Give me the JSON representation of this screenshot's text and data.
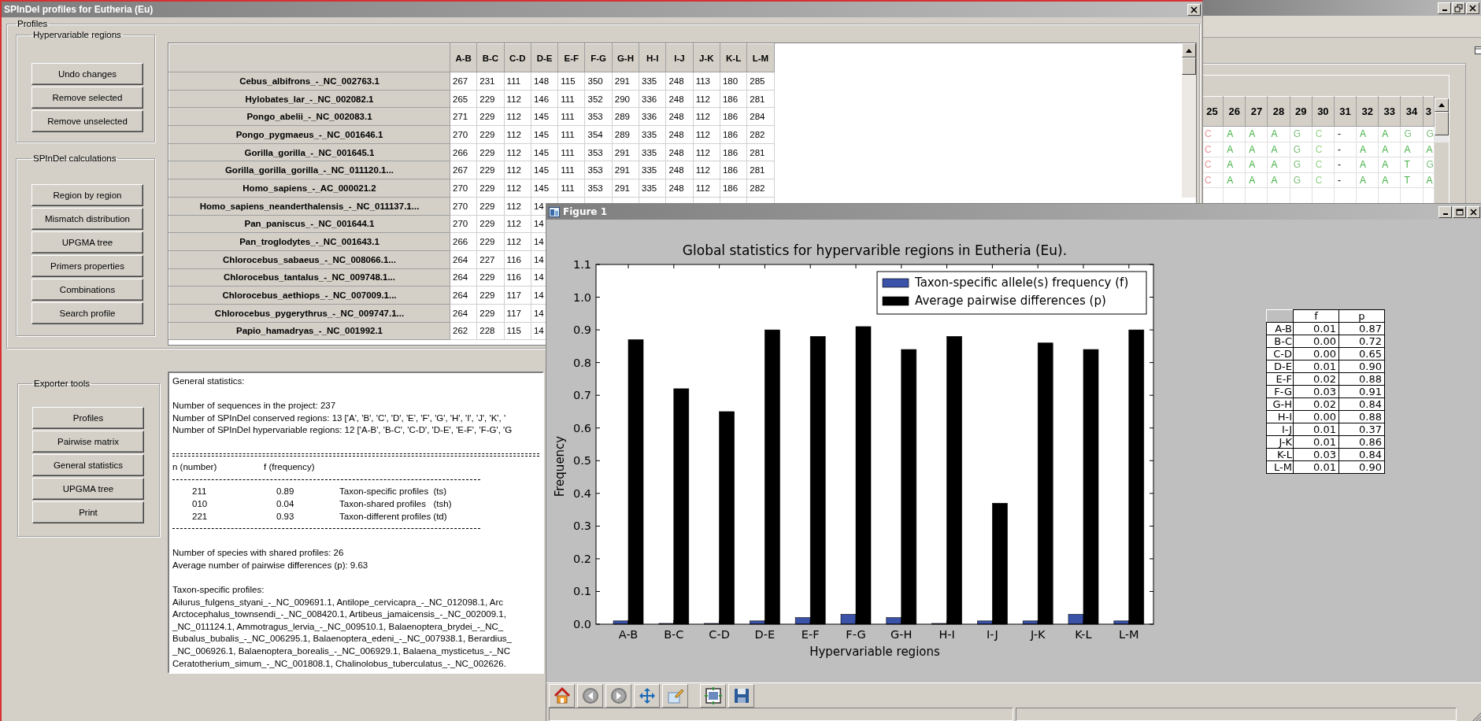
{
  "sequence_window": {
    "columns": [
      "25",
      "26",
      "27",
      "28",
      "29",
      "30",
      "31",
      "32",
      "33",
      "34",
      "3"
    ],
    "rows": [
      {
        "cells": [
          {
            "text": "C",
            "color": "#e89a9a"
          },
          {
            "text": "A",
            "color": "#44b044"
          },
          {
            "text": "A",
            "color": "#44b044"
          },
          {
            "text": "A",
            "color": "#44b044"
          },
          {
            "text": "G",
            "color": "#80c080"
          },
          {
            "text": "C",
            "color": "#98d488"
          },
          {
            "text": "-"
          },
          {
            "text": "A",
            "color": "#44b044"
          },
          {
            "text": "A",
            "color": "#44b044"
          },
          {
            "text": "G",
            "color": "#80c080"
          },
          {
            "text": "G",
            "color": "#80c080"
          }
        ]
      },
      {
        "cells": [
          {
            "text": "C",
            "color": "#e89a9a"
          },
          {
            "text": "A",
            "color": "#44b044"
          },
          {
            "text": "A",
            "color": "#44b044"
          },
          {
            "text": "A",
            "color": "#44b044"
          },
          {
            "text": "G",
            "color": "#80c080"
          },
          {
            "text": "C",
            "color": "#98d488"
          },
          {
            "text": "-"
          },
          {
            "text": "A",
            "color": "#44b044"
          },
          {
            "text": "A",
            "color": "#44b044"
          },
          {
            "text": "A",
            "color": "#44b044"
          },
          {
            "text": "A",
            "color": "#44b044"
          }
        ]
      },
      {
        "cells": [
          {
            "text": "C",
            "color": "#e89a9a"
          },
          {
            "text": "A",
            "color": "#44b044"
          },
          {
            "text": "A",
            "color": "#44b044"
          },
          {
            "text": "A",
            "color": "#44b044"
          },
          {
            "text": "G",
            "color": "#80c080"
          },
          {
            "text": "C",
            "color": "#98d488"
          },
          {
            "text": "-"
          },
          {
            "text": "A",
            "color": "#44b044"
          },
          {
            "text": "A",
            "color": "#44b044"
          },
          {
            "text": "T",
            "color": "#44b044"
          },
          {
            "text": "G",
            "color": "#80c080"
          }
        ]
      },
      {
        "cells": [
          {
            "text": "C",
            "color": "#e89a9a"
          },
          {
            "text": "A",
            "color": "#44b044"
          },
          {
            "text": "A",
            "color": "#44b044"
          },
          {
            "text": "A",
            "color": "#44b044"
          },
          {
            "text": "G",
            "color": "#80c080"
          },
          {
            "text": "C",
            "color": "#98d488"
          },
          {
            "text": "-"
          },
          {
            "text": "A",
            "color": "#44b044"
          },
          {
            "text": "A",
            "color": "#44b044"
          },
          {
            "text": "T",
            "color": "#44b044"
          },
          {
            "text": "A",
            "color": "#44b044"
          }
        ]
      }
    ]
  },
  "main_window": {
    "title": "SPInDel profiles for Eutheria (Eu)",
    "profiles": {
      "title": "Profiles",
      "hypervariable_regions": {
        "title": "Hypervariable regions",
        "buttons": [
          "Undo changes",
          "Remove selected",
          "Remove unselected"
        ]
      },
      "calculations": {
        "title": "SPInDel calculations",
        "buttons": [
          "Region by region",
          "Mismatch distribution",
          "UPGMA tree",
          "Primers properties",
          "Combinations",
          "Search profile"
        ]
      },
      "table": {
        "columns": [
          "A-B",
          "B-C",
          "C-D",
          "D-E",
          "E-F",
          "F-G",
          "G-H",
          "H-I",
          "I-J",
          "J-K",
          "K-L",
          "L-M"
        ],
        "rows": [
          {
            "name": "Cebus_albifrons_-_NC_002763.1",
            "values": [
              "267",
              "231",
              "111",
              "148",
              "115",
              "350",
              "291",
              "335",
              "248",
              "113",
              "180",
              "285"
            ]
          },
          {
            "name": "Hylobates_lar_-_NC_002082.1",
            "values": [
              "265",
              "229",
              "112",
              "146",
              "111",
              "352",
              "290",
              "336",
              "248",
              "112",
              "186",
              "281"
            ]
          },
          {
            "name": "Pongo_abelii_-_NC_002083.1",
            "values": [
              "271",
              "229",
              "112",
              "145",
              "111",
              "353",
              "289",
              "336",
              "248",
              "112",
              "186",
              "284"
            ]
          },
          {
            "name": "Pongo_pygmaeus_-_NC_001646.1",
            "values": [
              "270",
              "229",
              "112",
              "145",
              "111",
              "354",
              "289",
              "335",
              "248",
              "112",
              "186",
              "282"
            ]
          },
          {
            "name": "Gorilla_gorilla_-_NC_001645.1",
            "values": [
              "266",
              "229",
              "112",
              "145",
              "111",
              "353",
              "291",
              "335",
              "248",
              "112",
              "186",
              "281"
            ]
          },
          {
            "name": "Gorilla_gorilla_gorilla_-_NC_011120.1...",
            "values": [
              "267",
              "229",
              "112",
              "145",
              "111",
              "353",
              "291",
              "335",
              "248",
              "112",
              "186",
              "281"
            ]
          },
          {
            "name": "Homo_sapiens_-_AC_000021.2",
            "values": [
              "270",
              "229",
              "112",
              "145",
              "111",
              "353",
              "291",
              "335",
              "248",
              "112",
              "186",
              "282"
            ]
          },
          {
            "name": "Homo_sapiens_neanderthalensis_-_NC_011137.1...",
            "values": [
              "270",
              "229",
              "112",
              "14"
            ]
          },
          {
            "name": "Pan_paniscus_-_NC_001644.1",
            "values": [
              "270",
              "229",
              "112",
              "14"
            ]
          },
          {
            "name": "Pan_troglodytes_-_NC_001643.1",
            "values": [
              "266",
              "229",
              "112",
              "14"
            ]
          },
          {
            "name": "Chlorocebus_sabaeus_-_NC_008066.1...",
            "values": [
              "264",
              "227",
              "116",
              "14"
            ]
          },
          {
            "name": "Chlorocebus_tantalus_-_NC_009748.1...",
            "values": [
              "264",
              "229",
              "116",
              "14"
            ]
          },
          {
            "name": "Chlorocebus_aethiops_-_NC_007009.1...",
            "values": [
              "264",
              "229",
              "117",
              "14"
            ]
          },
          {
            "name": "Chlorocebus_pygerythrus_-_NC_009747.1...",
            "values": [
              "264",
              "229",
              "117",
              "14"
            ]
          },
          {
            "name": "Papio_hamadryas_-_NC_001992.1",
            "values": [
              "262",
              "228",
              "115",
              "14"
            ]
          }
        ]
      }
    },
    "exporter_tools": {
      "title": "Exporter tools",
      "buttons": [
        "Profiles",
        "Pairwise matrix",
        "General statistics",
        "UPGMA tree",
        "Print"
      ]
    },
    "output_text": {
      "heading": "General statistics:",
      "summary_lines": [
        "Number of sequences in the project: 237",
        "Number of SPInDel conserved regions: 13 ['A', 'B', 'C', 'D', 'E', 'F', 'G', 'H', 'I', 'J', 'K', '",
        "Number of SPInDel hypervariable regions: 12 ['A-B', 'B-C', 'C-D', 'D-E', 'E-F', 'F-G', 'G"
      ],
      "stats_header": [
        "n (number)",
        "f (frequency)"
      ],
      "stats_rows": [
        {
          "n": "211",
          "f": "0.89",
          "label": "Taxon-specific profiles  (ts)"
        },
        {
          "n": "010",
          "f": "0.04",
          "label": "Taxon-shared profiles   (tsh)"
        },
        {
          "n": "221",
          "f": "0.93",
          "label": "Taxon-different profiles (td)"
        }
      ],
      "notes": [
        "Number of species with shared profiles: 26",
        "Average number of pairwise differences (p): 9.63"
      ],
      "list_heading": "Taxon-specific profiles:",
      "list_lines": [
        "Ailurus_fulgens_styani_-_NC_009691.1, Antilope_cervicapra_-_NC_012098.1, Arc",
        "Arctocephalus_townsendi_-_NC_008420.1, Artibeus_jamaicensis_-_NC_002009.1,",
        "_NC_011124.1, Ammotragus_lervia_-_NC_009510.1, Balaenoptera_brydei_-_NC_",
        "Bubalus_bubalis_-_NC_006295.1, Balaenoptera_edeni_-_NC_007938.1, Berardius_",
        "_NC_006926.1, Balaenoptera_borealis_-_NC_006929.1, Balaena_mysticetus_-_NC",
        "Ceratotherium_simum_-_NC_001808.1, Chalinolobus_tuberculatus_-_NC_002626."
      ]
    }
  },
  "figure_window": {
    "title": "Figure 1",
    "chart_data": {
      "type": "bar",
      "title": "Global statistics for hypervarible regions in Eutheria (Eu).",
      "xlabel": "Hypervariable regions",
      "ylabel": "Frequency",
      "categories": [
        "A-B",
        "B-C",
        "C-D",
        "D-E",
        "E-F",
        "F-G",
        "G-H",
        "H-I",
        "I-J",
        "J-K",
        "K-L",
        "L-M"
      ],
      "series": [
        {
          "name": "Taxon-specific allele(s) frequency (f)",
          "color": "#3a52a8",
          "values": [
            0.01,
            0.0,
            0.0,
            0.01,
            0.02,
            0.03,
            0.02,
            0.0,
            0.01,
            0.01,
            0.03,
            0.01
          ]
        },
        {
          "name": "Average pairwise differences (p)",
          "color": "#000000",
          "values": [
            0.87,
            0.72,
            0.65,
            0.9,
            0.88,
            0.91,
            0.84,
            0.88,
            0.37,
            0.86,
            0.84,
            0.9
          ]
        }
      ],
      "legend": true,
      "ylim": [
        0,
        1.1
      ],
      "yticks": [
        {
          "value": 0,
          "label": "0.0"
        },
        0.1,
        0.2,
        0.3,
        0.4,
        0.5,
        0.6,
        0.7,
        0.8,
        0.9,
        {
          "value": 1,
          "label": "1.0"
        },
        1.1
      ]
    },
    "stats_table": {
      "columns": [
        "f",
        "p"
      ],
      "rows": [
        {
          "label": "A-B",
          "f": "0.01",
          "p": "0.87"
        },
        {
          "label": "B-C",
          "f": "0.00",
          "p": "0.72"
        },
        {
          "label": "C-D",
          "f": "0.00",
          "p": "0.65"
        },
        {
          "label": "D-E",
          "f": "0.01",
          "p": "0.90"
        },
        {
          "label": "E-F",
          "f": "0.02",
          "p": "0.88"
        },
        {
          "label": "F-G",
          "f": "0.03",
          "p": "0.91"
        },
        {
          "label": "G-H",
          "f": "0.02",
          "p": "0.84"
        },
        {
          "label": "H-I",
          "f": "0.00",
          "p": "0.88"
        },
        {
          "label": "I-J",
          "f": "0.01",
          "p": "0.37"
        },
        {
          "label": "J-K",
          "f": "0.01",
          "p": "0.86"
        },
        {
          "label": "K-L",
          "f": "0.03",
          "p": "0.84"
        },
        {
          "label": "L-M",
          "f": "0.01",
          "p": "0.90"
        }
      ]
    }
  }
}
